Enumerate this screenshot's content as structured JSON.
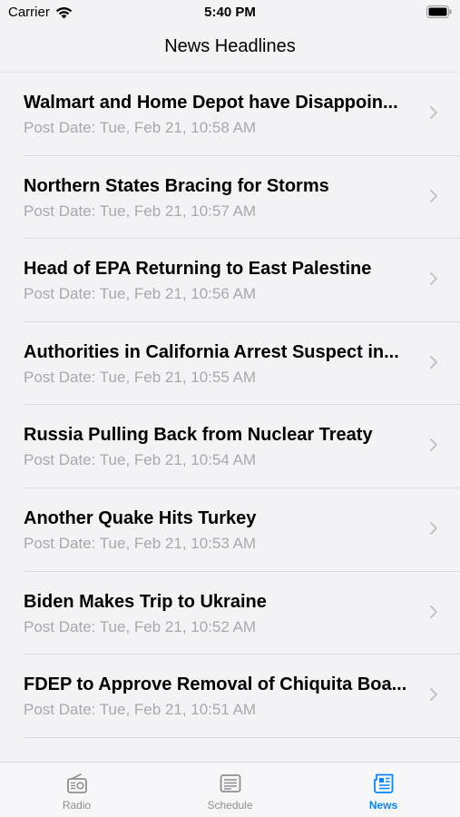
{
  "status_bar": {
    "carrier": "Carrier",
    "time": "5:40 PM"
  },
  "nav": {
    "title": "News Headlines"
  },
  "articles": [
    {
      "title": "Walmart and Home Depot have Disappoin...",
      "date": "Post Date: Tue, Feb 21, 10:58 AM"
    },
    {
      "title": "Northern States Bracing for Storms",
      "date": "Post Date: Tue, Feb 21, 10:57 AM"
    },
    {
      "title": "Head of EPA Returning to East Palestine",
      "date": "Post Date: Tue, Feb 21, 10:56 AM"
    },
    {
      "title": "Authorities in California Arrest Suspect in...",
      "date": "Post Date: Tue, Feb 21, 10:55 AM"
    },
    {
      "title": "Russia Pulling Back from Nuclear Treaty",
      "date": "Post Date: Tue, Feb 21, 10:54 AM"
    },
    {
      "title": "Another Quake Hits Turkey",
      "date": "Post Date: Tue, Feb 21, 10:53 AM"
    },
    {
      "title": "Biden Makes Trip to Ukraine",
      "date": "Post Date: Tue, Feb 21, 10:52 AM"
    },
    {
      "title": "FDEP to Approve Removal of Chiquita Boa...",
      "date": "Post Date: Tue, Feb 21, 10:51 AM"
    }
  ],
  "tabs": [
    {
      "label": "Radio",
      "icon": "radio-icon"
    },
    {
      "label": "Schedule",
      "icon": "schedule-icon"
    },
    {
      "label": "News",
      "icon": "news-icon"
    }
  ],
  "colors": {
    "accent": "#0a84ff",
    "secondary_text": "#a8a8ad",
    "background": "#f2f2f7"
  }
}
